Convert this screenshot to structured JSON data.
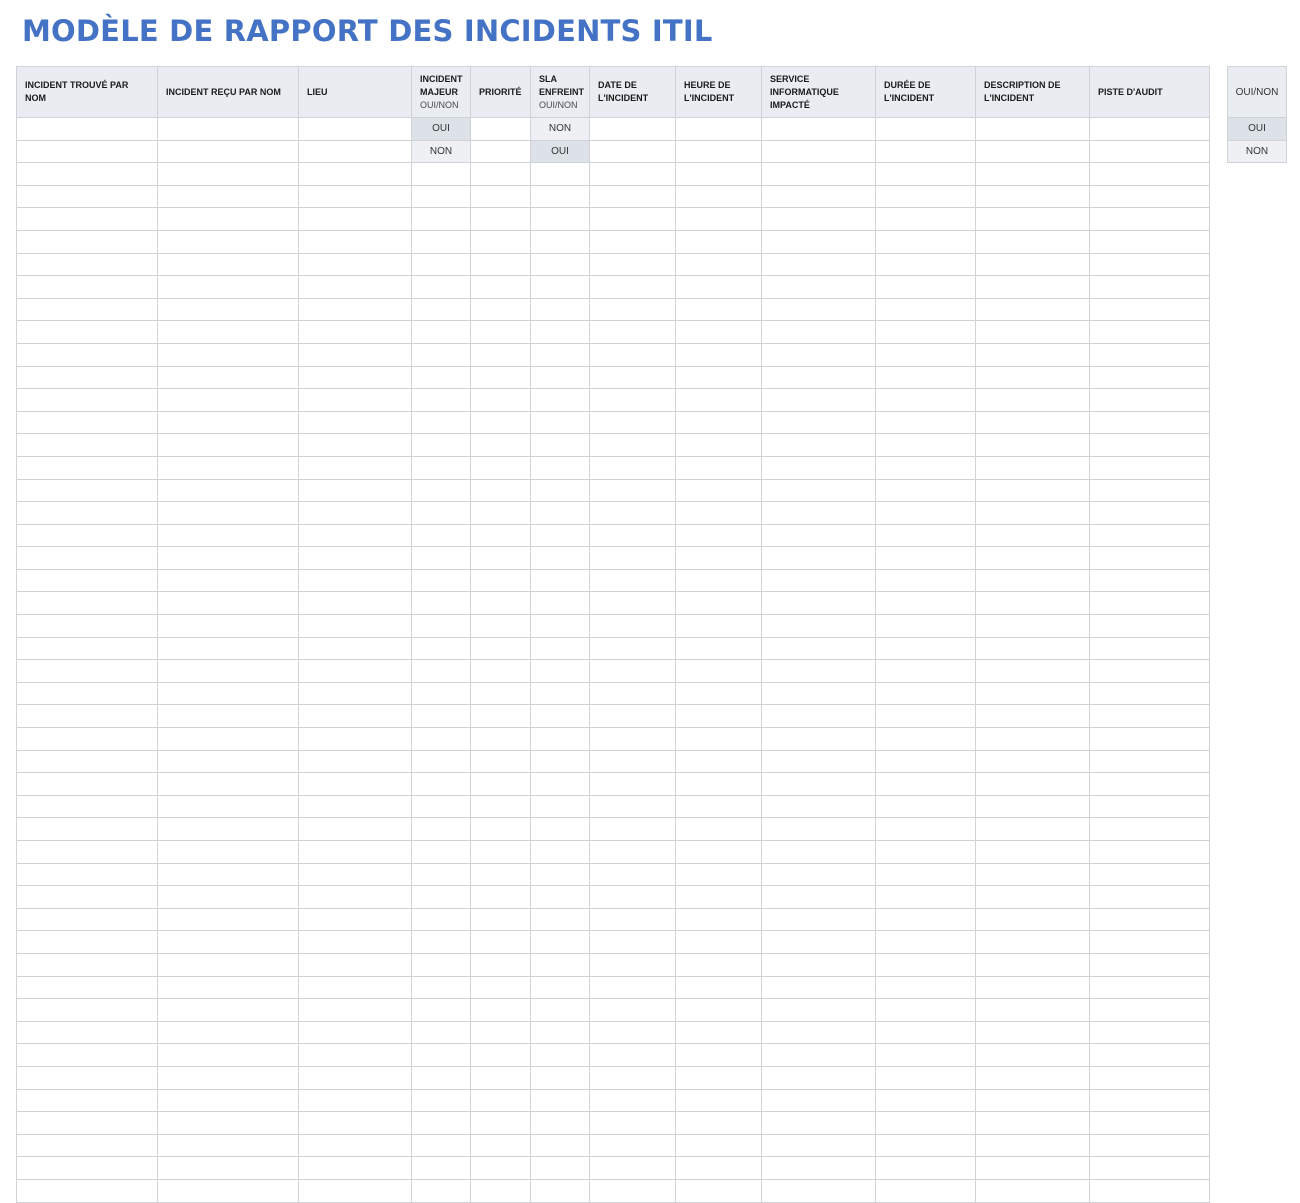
{
  "title": "MODÈLE DE RAPPORT DES INCIDENTS ITIL",
  "colors": {
    "title": "#4472c4",
    "header_bg": "#e9ecf1",
    "grid": "#cfd3d8",
    "cell_shade_light": "#eef0f3",
    "cell_shade_mid": "#dde2e9"
  },
  "columns": [
    {
      "key": "found_by",
      "label": "INCIDENT TROUVÉ PAR NOM",
      "sub": ""
    },
    {
      "key": "received_by",
      "label": "INCIDENT REÇU PAR NOM",
      "sub": ""
    },
    {
      "key": "location",
      "label": "LIEU",
      "sub": ""
    },
    {
      "key": "major",
      "label": "INCIDENT MAJEUR",
      "sub": "OUI/NON"
    },
    {
      "key": "priority",
      "label": "PRIORITÉ",
      "sub": ""
    },
    {
      "key": "sla",
      "label": "SLA ENFREINT",
      "sub": "OUI/NON"
    },
    {
      "key": "date",
      "label": "DATE DE L'INCIDENT",
      "sub": ""
    },
    {
      "key": "time",
      "label": "HEURE DE L'INCIDENT",
      "sub": ""
    },
    {
      "key": "service",
      "label": "SERVICE INFORMATIQUE IMPACTÉ",
      "sub": ""
    },
    {
      "key": "duration",
      "label": "DURÉE DE L'INCIDENT",
      "sub": ""
    },
    {
      "key": "description",
      "label": "DESCRIPTION DE L'INCIDENT",
      "sub": ""
    },
    {
      "key": "audit",
      "label": "PISTE D'AUDIT",
      "sub": ""
    }
  ],
  "rows": [
    {
      "major": "OUI",
      "sla": "NON"
    },
    {
      "major": "NON",
      "sla": "OUI"
    }
  ],
  "blank_row_count": 46,
  "side_list": {
    "header": "OUI/NON",
    "items": [
      "OUI",
      "NON"
    ]
  }
}
